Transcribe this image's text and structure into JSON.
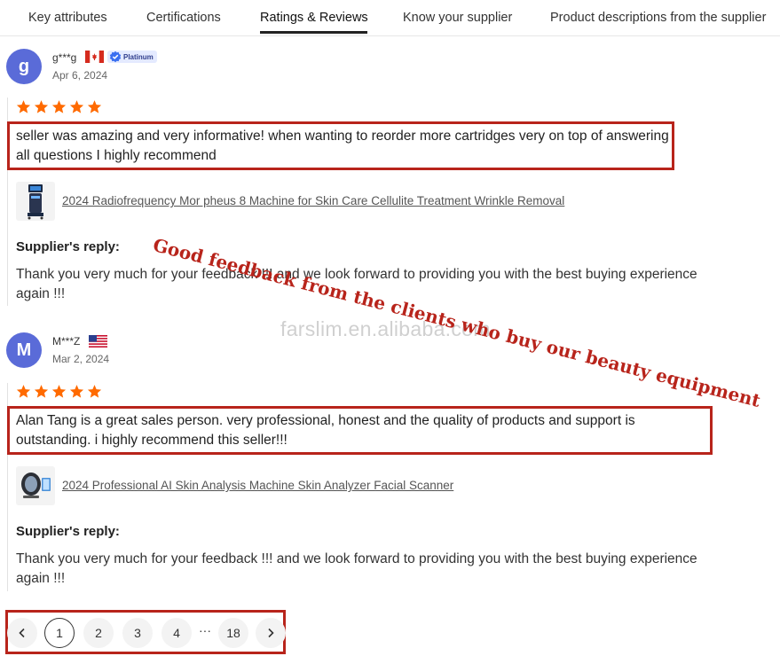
{
  "tabs": [
    {
      "label": "Key attributes"
    },
    {
      "label": "Certifications"
    },
    {
      "label": "Ratings & Reviews"
    },
    {
      "label": "Know your supplier"
    },
    {
      "label": "Product descriptions from the supplier"
    }
  ],
  "active_tab": "Ratings & Reviews",
  "reviews": [
    {
      "avatar_letter": "g",
      "username": "g***g",
      "country_flag": "canada-flag-icon",
      "badge": "Platinum",
      "date": "Apr 6, 2024",
      "rating": 5,
      "comment": "seller was amazing and very informative! when wanting to reorder more cartridges very on top of answering all questions I highly recommend",
      "product": "2024 Radiofrequency Mor pheus 8 Machine for Skin Care Cellulite Treatment Wrinkle Removal",
      "reply_title": "Supplier's reply:",
      "reply": "Thank you very much for your feedback !!! and we look forward to providing you with the best buying experience again !!!"
    },
    {
      "avatar_letter": "M",
      "username": "M***Z",
      "country_flag": "usa-flag-icon",
      "date": "Mar 2, 2024",
      "rating": 5,
      "comment": "Alan Tang is a great sales person. very professional, honest and the quality of products and support is outstanding. i highly recommend this seller!!!",
      "product": "2024 Professional AI Skin Analysis Machine Skin Analyzer Facial Scanner",
      "reply_title": "Supplier's reply:",
      "reply": "Thank you very much for your feedback !!! and we look forward to providing you with the best buying experience again !!!"
    }
  ],
  "pagination": {
    "current": "1",
    "pages": [
      "1",
      "2",
      "3",
      "4"
    ],
    "ellipsis": "···",
    "last": "18",
    "prev_icon": "chevron-left-icon",
    "next_icon": "chevron-right-icon"
  },
  "annotation": "Good feedback from the clients who buy our beauty equipment",
  "watermark": "farslim.en.alibaba.com",
  "colors": {
    "star": "#ff6a00",
    "highlight_border": "#b8241b",
    "avatar": "#5a6bd8",
    "annotation": "#b8241b"
  }
}
